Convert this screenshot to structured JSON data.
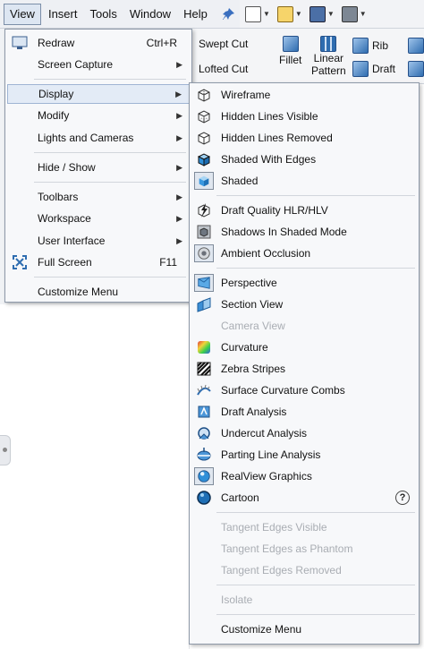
{
  "menubar": {
    "items": [
      {
        "label": "View",
        "active": true
      },
      {
        "label": "Insert"
      },
      {
        "label": "Tools"
      },
      {
        "label": "Window"
      },
      {
        "label": "Help"
      }
    ],
    "pin_icon": "pin-icon"
  },
  "toolbar": {
    "buttons": [
      "new-document-icon",
      "open-folder-icon",
      "save-icon",
      "print-icon"
    ]
  },
  "ribbon": {
    "swept_cut": "Swept Cut",
    "lofted_cut": "Lofted Cut",
    "fillet": "Fillet",
    "linear_pattern_1": "Linear",
    "linear_pattern_2": "Pattern",
    "rib": "Rib",
    "draft": "Draft"
  },
  "view_menu": {
    "items": [
      {
        "label": "Redraw",
        "shortcut": "Ctrl+R",
        "icon": "redraw-icon"
      },
      {
        "label": "Screen Capture",
        "submenu": true
      },
      {
        "label": "Display",
        "submenu": true,
        "highlighted": true
      },
      {
        "label": "Modify",
        "submenu": true
      },
      {
        "label": "Lights and Cameras",
        "submenu": true
      },
      {
        "label": "Hide / Show",
        "submenu": true
      },
      {
        "label": "Toolbars",
        "submenu": true
      },
      {
        "label": "Workspace",
        "submenu": true
      },
      {
        "label": "User Interface",
        "submenu": true
      },
      {
        "label": "Full Screen",
        "shortcut": "F11",
        "icon": "full-screen-icon"
      },
      {
        "label": "Customize Menu"
      }
    ]
  },
  "display_submenu": {
    "items": [
      {
        "label": "Wireframe",
        "icon": "wireframe-icon"
      },
      {
        "label": "Hidden Lines Visible",
        "icon": "hidden-lines-visible-icon"
      },
      {
        "label": "Hidden Lines Removed",
        "icon": "hidden-lines-removed-icon"
      },
      {
        "label": "Shaded With Edges",
        "icon": "shaded-with-edges-icon"
      },
      {
        "label": "Shaded",
        "icon": "shaded-icon",
        "checked": true
      },
      {
        "label": "Draft Quality HLR/HLV",
        "icon": "draft-quality-icon"
      },
      {
        "label": "Shadows In Shaded Mode",
        "icon": "shadows-icon"
      },
      {
        "label": "Ambient Occlusion",
        "icon": "ambient-occlusion-icon"
      },
      {
        "label": "Perspective",
        "icon": "perspective-icon",
        "checked": true
      },
      {
        "label": "Section View",
        "icon": "section-view-icon"
      },
      {
        "label": "Camera View",
        "icon": "camera-view-icon",
        "disabled": true
      },
      {
        "label": "Curvature",
        "icon": "curvature-icon"
      },
      {
        "label": "Zebra Stripes",
        "icon": "zebra-stripes-icon"
      },
      {
        "label": "Surface Curvature Combs",
        "icon": "curvature-combs-icon"
      },
      {
        "label": "Draft Analysis",
        "icon": "draft-analysis-icon"
      },
      {
        "label": "Undercut Analysis",
        "icon": "undercut-analysis-icon"
      },
      {
        "label": "Parting Line Analysis",
        "icon": "parting-line-icon"
      },
      {
        "label": "RealView Graphics",
        "icon": "realview-icon",
        "checked": true
      },
      {
        "label": "Cartoon",
        "icon": "cartoon-icon",
        "help": "?"
      },
      {
        "label": "Tangent Edges Visible",
        "disabled": true
      },
      {
        "label": "Tangent Edges as Phantom",
        "disabled": true
      },
      {
        "label": "Tangent Edges Removed",
        "disabled": true
      },
      {
        "label": "Isolate",
        "disabled": true
      },
      {
        "label": "Customize Menu"
      }
    ]
  },
  "colors": {
    "menu_bg": "#f7f8fa",
    "highlight": "#e3ebf6",
    "disabled_text": "#a9adb3",
    "accent_blue": "#2f6db0"
  }
}
